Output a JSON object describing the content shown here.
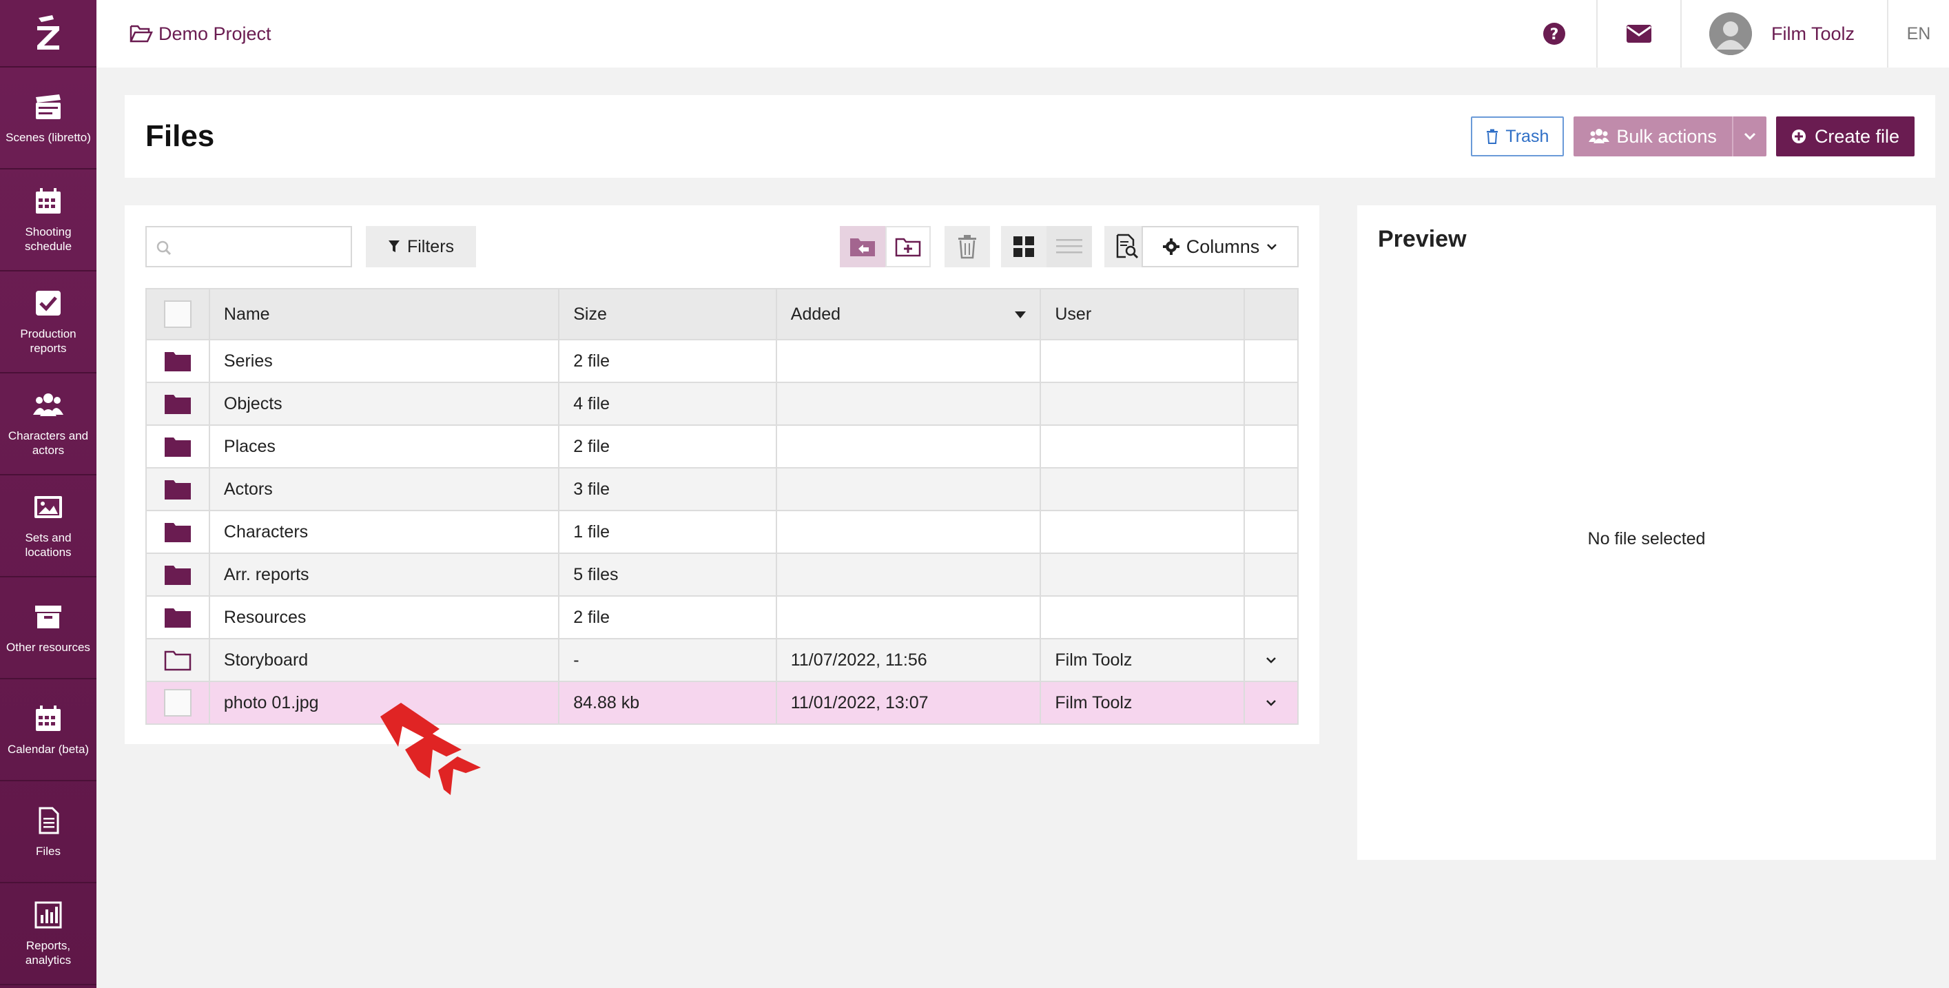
{
  "sidebar": {
    "logo_alt": "Z",
    "items": [
      {
        "label": "Scenes (libretto)",
        "icon": "clapperboard-icon"
      },
      {
        "label": "Shooting schedule",
        "icon": "calendar-icon"
      },
      {
        "label": "Production reports",
        "icon": "checkbox-icon"
      },
      {
        "label": "Characters and actors",
        "icon": "users-icon"
      },
      {
        "label": "Sets and locations",
        "icon": "image-icon"
      },
      {
        "label": "Other resources",
        "icon": "archive-icon"
      },
      {
        "label": "Calendar (beta)",
        "icon": "calendar-icon"
      },
      {
        "label": "Files",
        "icon": "file-icon"
      },
      {
        "label": "Reports, analytics",
        "icon": "bar-chart-icon"
      }
    ]
  },
  "topbar": {
    "project": "Demo Project",
    "user_name": "Film Toolz",
    "lang": "EN"
  },
  "header": {
    "title": "Files",
    "trash_label": "Trash",
    "bulk_label": "Bulk actions",
    "create_label": "Create file"
  },
  "toolbar": {
    "search_placeholder": "",
    "filters_label": "Filters",
    "columns_label": "Columns"
  },
  "table": {
    "headers": {
      "name": "Name",
      "size": "Size",
      "added": "Added",
      "user": "User"
    },
    "rows": [
      {
        "type": "folder",
        "name": "Series",
        "size": "2 file",
        "added": "",
        "user": ""
      },
      {
        "type": "folder",
        "name": "Objects",
        "size": "4 file",
        "added": "",
        "user": ""
      },
      {
        "type": "folder",
        "name": "Places",
        "size": "2 file",
        "added": "",
        "user": ""
      },
      {
        "type": "folder",
        "name": "Actors",
        "size": "3 file",
        "added": "",
        "user": ""
      },
      {
        "type": "folder",
        "name": "Characters",
        "size": "1 file",
        "added": "",
        "user": ""
      },
      {
        "type": "folder",
        "name": "Arr. reports",
        "size": "5 files",
        "added": "",
        "user": ""
      },
      {
        "type": "folder",
        "name": "Resources",
        "size": "2 file",
        "added": "",
        "user": ""
      },
      {
        "type": "folder-outline",
        "name": "Storyboard",
        "size": "-",
        "added": "11/07/2022, 11:56",
        "user": "Film Toolz"
      },
      {
        "type": "file",
        "name": "photo 01.jpg",
        "size": "84.88 kb",
        "added": "11/01/2022, 13:07",
        "user": "Film Toolz"
      }
    ]
  },
  "preview": {
    "title": "Preview",
    "empty_text": "No file selected"
  },
  "colors": {
    "brand": "#6a1c51",
    "bulk_disabled": "#c08bab",
    "selected_row": "#f6d6ee",
    "trash_blue": "#2f6fc6"
  }
}
